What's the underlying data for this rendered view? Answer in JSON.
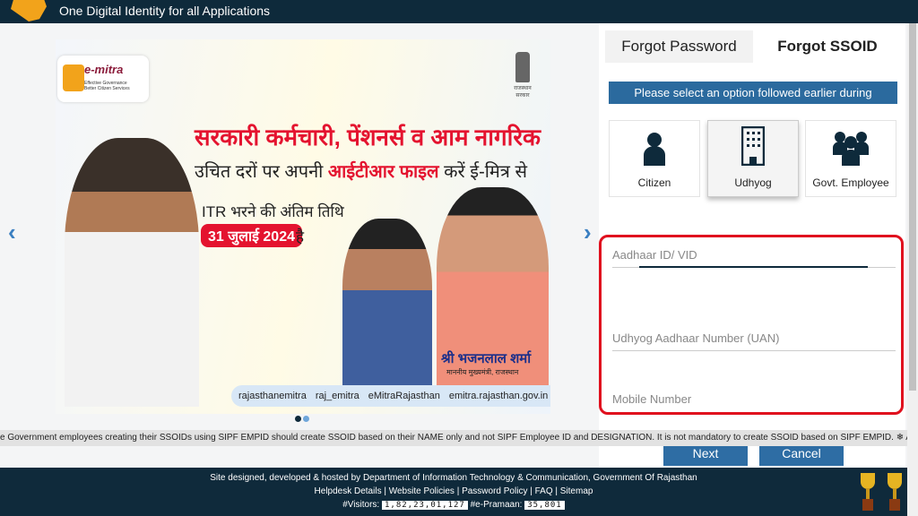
{
  "header": {
    "tagline": "One Digital Identity for all Applications"
  },
  "banner": {
    "logo_name": "e-mitra",
    "logo_sub": "Effective Governance Better Citizen Services",
    "emblem_text": "राजस्थान सरकार",
    "headline": "सरकारी कर्मचारी, पेंशनर्स व आम नागरिक",
    "line2_a": "उचित दरों पर अपनी",
    "line2_b": "आईटीआर फाइल",
    "line2_c": "करें ई-मित्र से",
    "line3": "ITR भरने की अंतिम तिथि",
    "date": "31 जुलाई 2024",
    "hai": "है",
    "cm_name": "श्री भजनलाल शर्मा",
    "cm_title": "माननीय मुख्यमंत्री, राजस्थान",
    "social": [
      "rajasthanemitra",
      "raj_emitra",
      "eMitraRajasthan",
      "emitra.rajasthan.gov.in"
    ]
  },
  "panel": {
    "tabs": [
      {
        "label": "Forgot Password",
        "active": false
      },
      {
        "label": "Forgot SSOID",
        "active": true
      }
    ],
    "instruction": "Please select an option followed earlier during registration",
    "options": [
      {
        "label": "Citizen",
        "icon": "person-icon"
      },
      {
        "label": "Udhyog",
        "icon": "building-icon",
        "selected": true
      },
      {
        "label": "Govt. Employee",
        "icon": "group-icon"
      }
    ],
    "fields": [
      {
        "placeholder": "Aadhaar ID/ VID",
        "value": ""
      },
      {
        "placeholder": "Udhyog Aadhaar Number (UAN)",
        "value": ""
      },
      {
        "placeholder": "Mobile Number",
        "value": ""
      }
    ],
    "next": "Next",
    "cancel": "Cancel"
  },
  "ticker": "e Government employees creating their SSOIDs using SIPF EMPID should create SSOID based on their NAME only and not SIPF Employee ID and DESIGNATION. It is not mandatory to create SSOID based on SIPF EMPID.    ❄ As per UIDAI Policy, UID number is no longer stored",
  "footer": {
    "credit": "Site designed, developed & hosted by Department of Information Technology & Communication, Government Of Rajasthan",
    "links": [
      "Helpdesk Details",
      "Website Policies",
      "Password Policy",
      "FAQ",
      "Sitemap"
    ],
    "visitors_label": "#Visitors:",
    "visitors": "1,82,23,01,127",
    "epramaan_label": "#e-Pramaan:",
    "epramaan": "35,801"
  },
  "colors": {
    "header": "#0e2a3b",
    "accent": "#2b6a9e",
    "highlight": "#e0101e"
  }
}
